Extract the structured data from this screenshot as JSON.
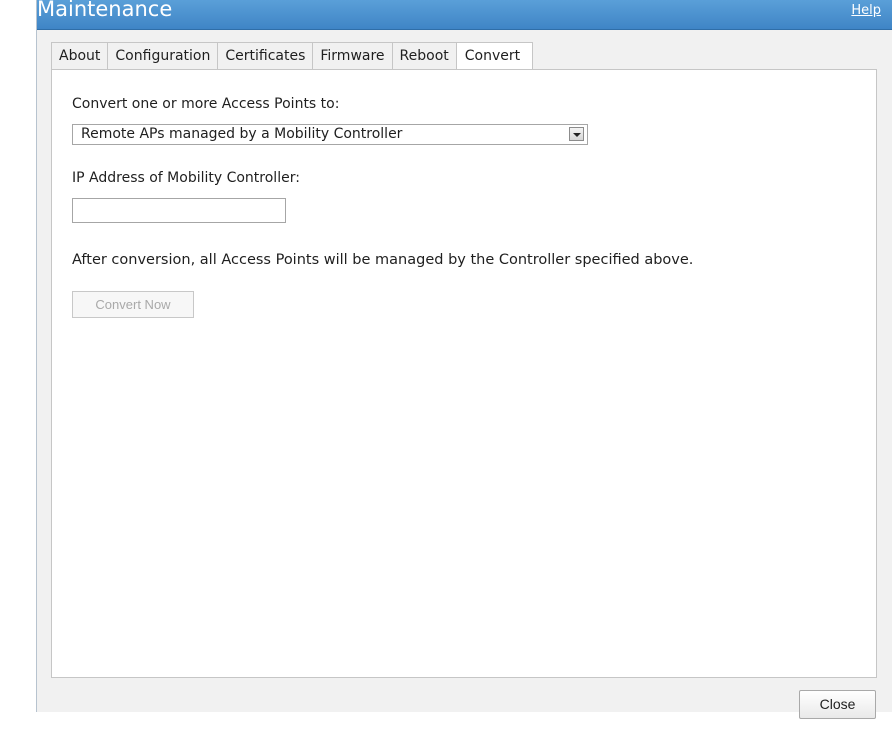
{
  "dialog": {
    "title": "Maintenance",
    "help_link": "Help"
  },
  "tabs": [
    {
      "label": "About",
      "active": false
    },
    {
      "label": "Configuration",
      "active": false
    },
    {
      "label": "Certificates",
      "active": false
    },
    {
      "label": "Firmware",
      "active": false
    },
    {
      "label": "Reboot",
      "active": false
    },
    {
      "label": "Convert",
      "active": true
    }
  ],
  "convert": {
    "prompt": "Convert one or more Access Points to:",
    "target_select": {
      "value": "Remote APs managed by a Mobility Controller"
    },
    "ip_label": "IP Address of Mobility Controller:",
    "ip_input": {
      "value": "",
      "placeholder": ""
    },
    "note": "After conversion, all Access Points will be managed by the Controller specified above.",
    "convert_button": "Convert Now"
  },
  "footer": {
    "close_button": "Close"
  },
  "colors": {
    "titlebar": "#4a92d0",
    "disabled_text": "#a9a9a9"
  },
  "icons": {
    "select_arrow": "chevron-down-icon"
  }
}
